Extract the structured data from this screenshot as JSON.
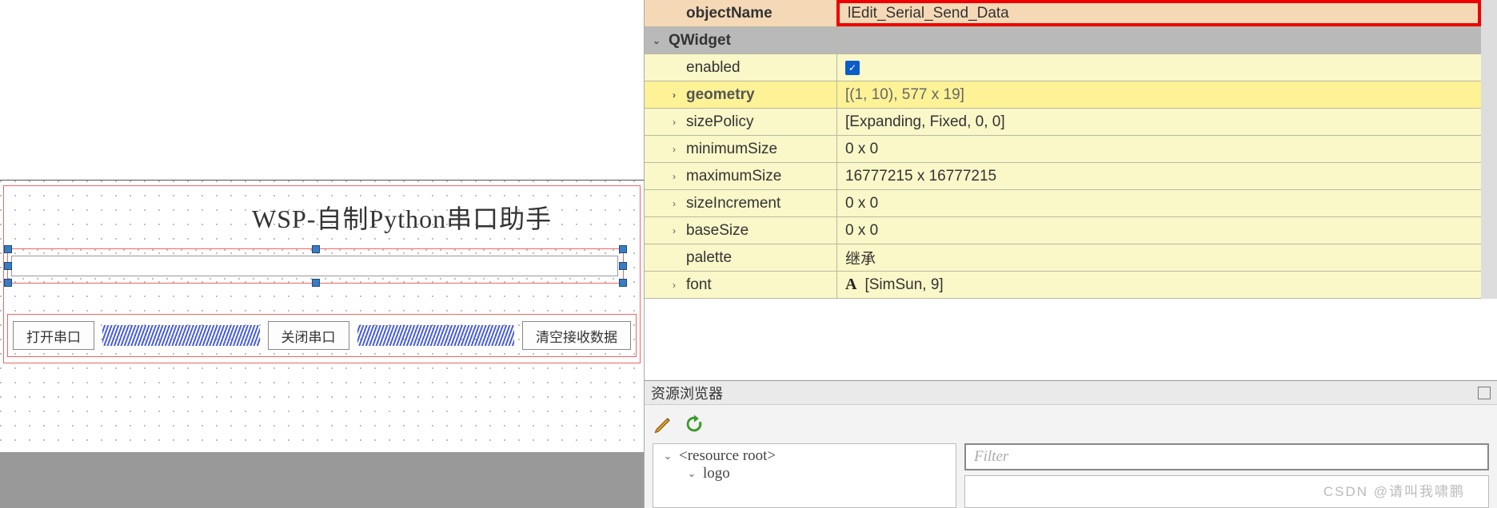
{
  "left": {
    "title": "WSP-自制Python串口助手",
    "buttons": {
      "open": "打开串口",
      "close": "关闭串口",
      "clear": "清空接收数据"
    }
  },
  "props": {
    "objectName": {
      "label": "objectName",
      "value": "lEdit_Serial_Send_Data"
    },
    "qwidget": "QWidget",
    "enabled": {
      "label": "enabled"
    },
    "geometry": {
      "label": "geometry",
      "value": "[(1, 10), 577 x 19]"
    },
    "sizePolicy": {
      "label": "sizePolicy",
      "value": "[Expanding, Fixed, 0, 0]"
    },
    "minimumSize": {
      "label": "minimumSize",
      "value": "0 x 0"
    },
    "maximumSize": {
      "label": "maximumSize",
      "value": "16777215 x 16777215"
    },
    "sizeIncrement": {
      "label": "sizeIncrement",
      "value": "0 x 0"
    },
    "baseSize": {
      "label": "baseSize",
      "value": "0 x 0"
    },
    "palette": {
      "label": "palette",
      "value": "继承"
    },
    "font": {
      "label": "font",
      "value": "[SimSun, 9]"
    }
  },
  "resource": {
    "title": "资源浏览器",
    "filter_placeholder": "Filter",
    "tree": {
      "root": "<resource root>",
      "logo": "logo"
    }
  },
  "watermark": "CSDN @请叫我啸鹏"
}
